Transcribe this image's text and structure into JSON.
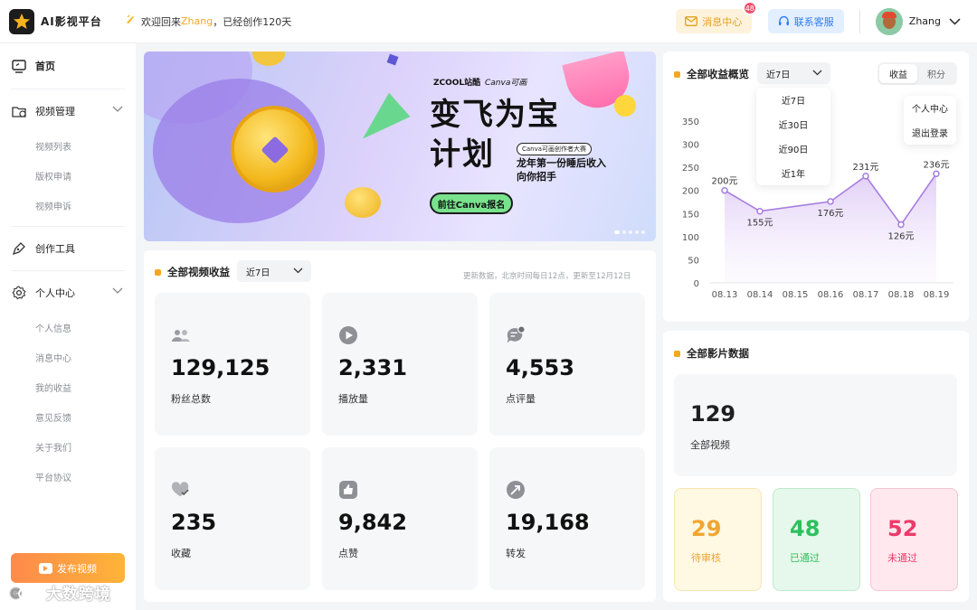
{
  "app": {
    "name": "AI影视平台"
  },
  "header": {
    "welcome_prefix": "欢迎回来",
    "user_highlight": "Zhang",
    "welcome_suffix": "，已经创作120天",
    "message_label": "消息中心",
    "message_badge": "48",
    "service_label": "联系客服",
    "user_name": "Zhang"
  },
  "sidebar": {
    "home": "首页",
    "groups": [
      {
        "label": "视频管理",
        "items": [
          "视频列表",
          "版权申请",
          "视频申诉"
        ]
      },
      {
        "label": "创作工具",
        "items": []
      },
      {
        "label": "个人中心",
        "items": [
          "个人信息",
          "消息中心",
          "我的收益",
          "意见反馈",
          "关于我们",
          "平台协议"
        ]
      }
    ],
    "publish_label": "发布视频",
    "watermark": "大数跨境"
  },
  "banner": {
    "brand1": "ZCOOL站酷",
    "brand2": "Canva可画",
    "title_line1": "变飞为宝",
    "title_line2": "计划",
    "tag": "Canva可画创作者大赛",
    "sub_line1": "龙年第一份睡后收入",
    "sub_line2": "向你招手",
    "cta": "前往Canva报名"
  },
  "video_revenue": {
    "title": "全部视频收益",
    "period": "近7日",
    "update_note": "更新数据，北京时间每日12点，更新至12月12日",
    "stats": [
      {
        "icon": "fans-icon",
        "value": "129,125",
        "label": "粉丝总数"
      },
      {
        "icon": "play-icon",
        "value": "2,331",
        "label": "播放量"
      },
      {
        "icon": "comment-icon",
        "value": "4,553",
        "label": "点评量"
      },
      {
        "icon": "heart-icon",
        "value": "235",
        "label": "收藏"
      },
      {
        "icon": "thumb-icon",
        "value": "9,842",
        "label": "点赞"
      },
      {
        "icon": "share-icon",
        "value": "19,168",
        "label": "转发"
      }
    ]
  },
  "earnings": {
    "title": "全部收益概览",
    "period": "近7日",
    "period_options": [
      "近7日",
      "近30日",
      "近90日",
      "近1年"
    ],
    "toggle": [
      "收益",
      "积分"
    ],
    "user_menu": [
      "个人中心",
      "退出登录"
    ]
  },
  "chart_data": {
    "type": "area",
    "categories": [
      "08.13",
      "08.14",
      "08.15",
      "08.16",
      "08.17",
      "08.18",
      "08.19"
    ],
    "values": [
      200,
      155,
      null,
      176,
      231,
      126,
      236
    ],
    "data_labels": [
      "200元",
      "155元",
      "",
      "176元",
      "231元",
      "126元",
      "236元"
    ],
    "y_ticks": [
      0,
      50,
      100,
      150,
      200,
      250,
      300,
      350
    ],
    "ylim": [
      0,
      350
    ],
    "grid": false,
    "color": "#a77ce0"
  },
  "film": {
    "title": "全部影片数据",
    "total_value": "129",
    "total_label": "全部视频",
    "statuses": [
      {
        "value": "29",
        "label": "待审核",
        "color": "#f0a630",
        "bg": "#fff8e3",
        "border": "#f6e6b0"
      },
      {
        "value": "48",
        "label": "已通过",
        "color": "#2fbf5e",
        "bg": "#e6f8ec",
        "border": "#bfe9cb"
      },
      {
        "value": "52",
        "label": "未通过",
        "color": "#ec3a6a",
        "bg": "#ffe9ef",
        "border": "#f7c4d2"
      }
    ]
  }
}
